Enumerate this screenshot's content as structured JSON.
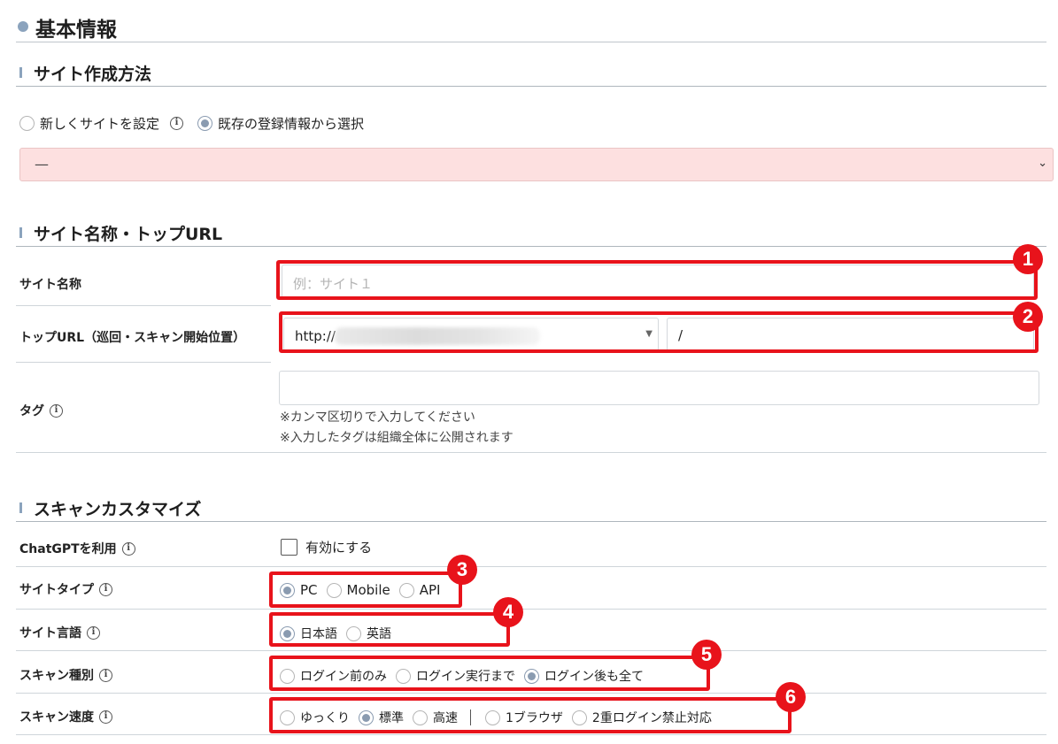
{
  "basic_info": {
    "title": "基本情報"
  },
  "site_creation": {
    "title": "サイト作成方法",
    "options": [
      {
        "label": "新しくサイトを設定",
        "selected": false
      },
      {
        "label": "既存の登録情報から選択",
        "selected": true
      }
    ],
    "select_value": "—"
  },
  "site_name_url": {
    "title": "サイト名称・トップURL",
    "site_name_label": "サイト名称",
    "site_name_placeholder": "例：サイト１",
    "top_url_label": "トップURL（巡回・スキャン開始位置）",
    "protocol": "http://",
    "path_value": "/",
    "tag_label": "タグ",
    "tag_note_1": "※カンマ区切りで入力してください",
    "tag_note_2": "※入力したタグは組織全体に公開されます"
  },
  "scan_custom": {
    "title": "スキャンカスタマイズ",
    "chatgpt_label": "ChatGPTを利用",
    "chatgpt_checkbox_label": "有効にする",
    "chatgpt_checked": false,
    "site_type_label": "サイトタイプ",
    "site_type_options": [
      "PC",
      "Mobile",
      "API"
    ],
    "site_type_selected": "PC",
    "site_lang_label": "サイト言語",
    "site_lang_options": [
      "日本語",
      "英語"
    ],
    "site_lang_selected": "日本語",
    "scan_kind_label": "スキャン種別",
    "scan_kind_options": [
      "ログイン前のみ",
      "ログイン実行まで",
      "ログイン後も全て"
    ],
    "scan_kind_selected": "ログイン後も全て",
    "scan_speed_label": "スキャン速度",
    "scan_speed_options": [
      "ゆっくり",
      "標準",
      "高速"
    ],
    "scan_speed_selected": "標準",
    "browser_options": [
      "1ブラウザ",
      "2重ログイン禁止対応"
    ]
  },
  "callouts": [
    "1",
    "2",
    "3",
    "4",
    "5",
    "6"
  ],
  "colors": {
    "callout_red": "#e8131b",
    "error_bg": "#fde0e0",
    "accent": "#8ba3bd"
  }
}
